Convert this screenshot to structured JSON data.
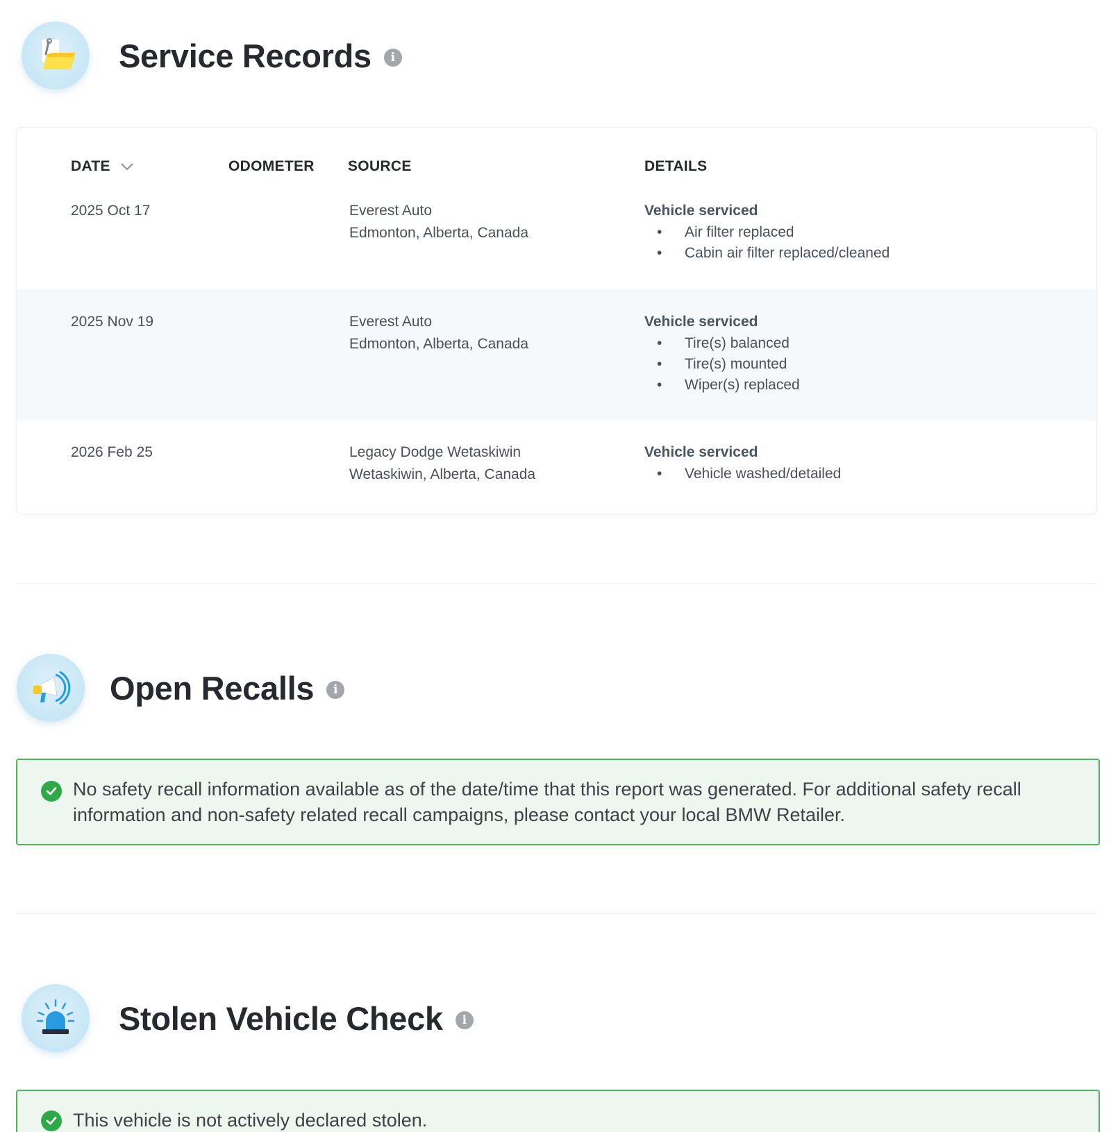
{
  "service_records": {
    "title": "Service Records",
    "info_icon": "i",
    "columns": {
      "date": "DATE",
      "odometer": "ODOMETER",
      "source": "SOURCE",
      "details": "DETAILS"
    },
    "rows": [
      {
        "date": "2025 Oct 17",
        "odometer": "",
        "source_name": "Everest Auto",
        "source_location": "Edmonton, Alberta, Canada",
        "details_title": "Vehicle serviced",
        "items": [
          "Air filter replaced",
          "Cabin air filter replaced/cleaned"
        ]
      },
      {
        "date": "2025 Nov 19",
        "odometer": "",
        "source_name": "Everest Auto",
        "source_location": "Edmonton, Alberta, Canada",
        "details_title": "Vehicle serviced",
        "items": [
          "Tire(s) balanced",
          "Tire(s) mounted",
          "Wiper(s) replaced"
        ]
      },
      {
        "date": "2026 Feb 25",
        "odometer": "",
        "source_name": "Legacy Dodge Wetaskiwin",
        "source_location": "Wetaskiwin, Alberta, Canada",
        "details_title": "Vehicle serviced",
        "items": [
          "Vehicle washed/detailed"
        ]
      }
    ]
  },
  "open_recalls": {
    "title": "Open Recalls",
    "info_icon": "i",
    "message": "No safety recall information available as of the date/time that this report was generated. For additional safety recall information and non-safety related recall campaigns, please contact your local BMW Retailer."
  },
  "stolen_check": {
    "title": "Stolen Vehicle Check",
    "info_icon": "i",
    "message": "This vehicle is not actively declared stolen."
  },
  "colors": {
    "success_border": "#4fb360",
    "success_bg": "#eef7ef",
    "check_green": "#2fa84a",
    "row_alt_bg": "#f6f9fc"
  }
}
